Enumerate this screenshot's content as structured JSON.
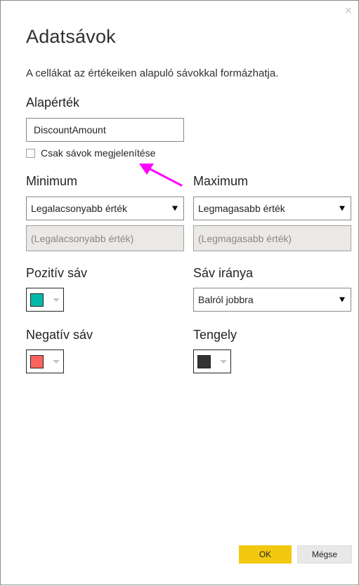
{
  "dialog": {
    "title": "Adatsávok",
    "description": "A cellákat az értékeiken alapuló sávokkal formázhatja.",
    "close_icon": "close-icon"
  },
  "base_value": {
    "label": "Alapérték",
    "value": "DiscountAmount"
  },
  "show_bars_only": {
    "label": "Csak sávok megjelenítése",
    "checked": false
  },
  "minimum": {
    "label": "Minimum",
    "selected": "Legalacsonyabb érték",
    "placeholder": "(Legalacsonyabb érték)"
  },
  "maximum": {
    "label": "Maximum",
    "selected": "Legmagasabb érték",
    "placeholder": "(Legmagasabb érték)"
  },
  "positive_bar": {
    "label": "Pozitív sáv",
    "color": "#01B8AA"
  },
  "bar_direction": {
    "label": "Sáv iránya",
    "selected": "Balról jobbra"
  },
  "negative_bar": {
    "label": "Negatív sáv",
    "color": "#FD625E"
  },
  "axis": {
    "label": "Tengely",
    "color": "#333333"
  },
  "annotation": {
    "arrow_color": "#FF00FF"
  },
  "buttons": {
    "ok": "OK",
    "cancel": "Mégse"
  }
}
